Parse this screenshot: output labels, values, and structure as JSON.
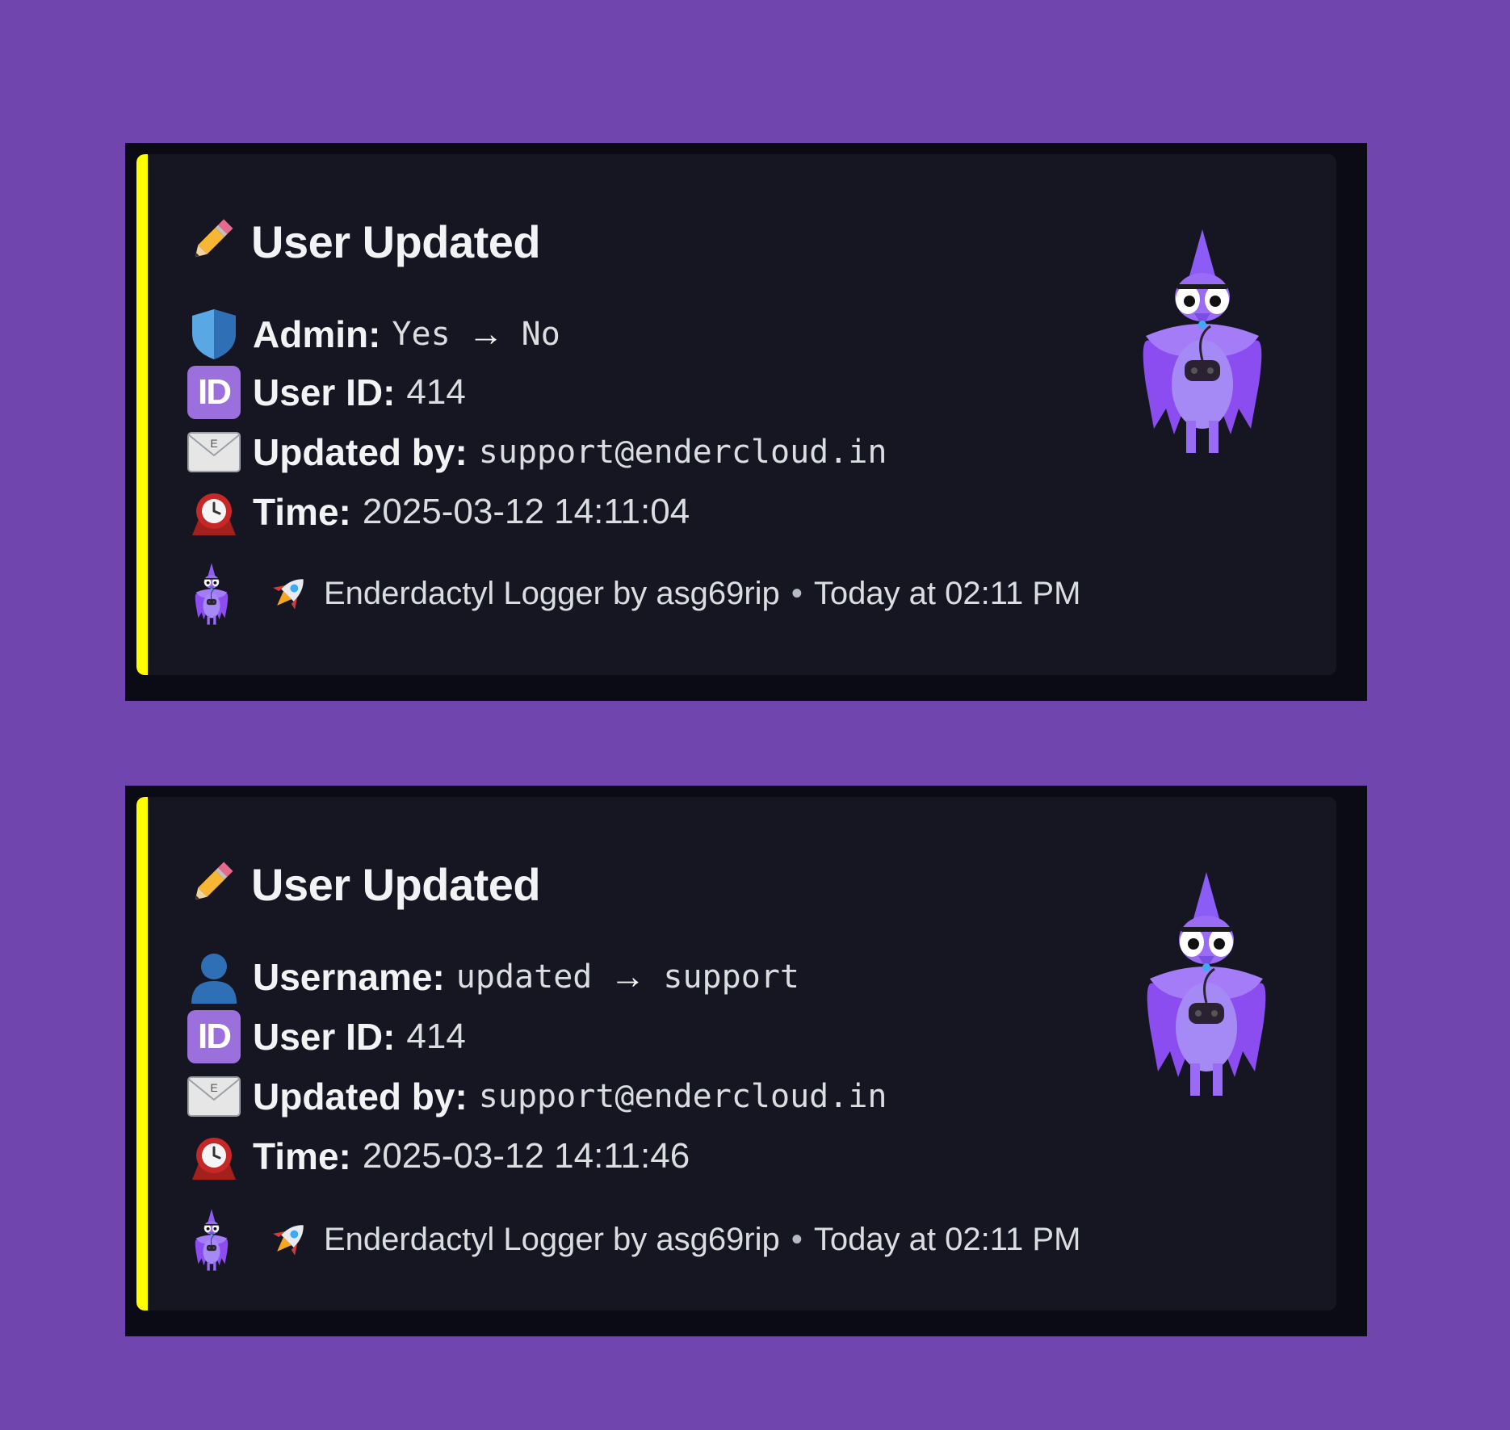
{
  "embeds": [
    {
      "title": "User Updated",
      "change": {
        "label": "Admin:",
        "from": "Yes",
        "arrow": "→",
        "to": "No"
      },
      "user_id": {
        "label": "User ID:",
        "value": "414"
      },
      "updated_by": {
        "label": "Updated by:",
        "value": "support@endercloud.in"
      },
      "time": {
        "label": "Time:",
        "value": "2025-03-12 14:11:04"
      },
      "footer": {
        "text": "Enderdactyl Logger by asg69rip",
        "separator": "•",
        "timestamp": "Today at 02:11 PM"
      }
    },
    {
      "title": "User Updated",
      "change": {
        "label": "Username:",
        "from": "updated",
        "arrow": "→",
        "to": "support"
      },
      "user_id": {
        "label": "User ID:",
        "value": "414"
      },
      "updated_by": {
        "label": "Updated by:",
        "value": "support@endercloud.in"
      },
      "time": {
        "label": "Time:",
        "value": "2025-03-12 14:11:46"
      },
      "footer": {
        "text": "Enderdactyl Logger by asg69rip",
        "separator": "•",
        "timestamp": "Today at 02:11 PM"
      }
    }
  ],
  "icons": {
    "title": "pencil-icon",
    "admin": "shield-icon",
    "username": "user-silhouette-icon",
    "id": "id-badge-icon",
    "updated_by": "envelope-icon",
    "time": "alarm-clock-icon",
    "footer_avatar": "pterodactyl-avatar-icon",
    "footer": "rocket-icon"
  },
  "colors": {
    "background": "#7145ae",
    "embed": "#161623",
    "accent": "#ffff00"
  },
  "id_badge_text": "ID",
  "envelope_letter": "E"
}
